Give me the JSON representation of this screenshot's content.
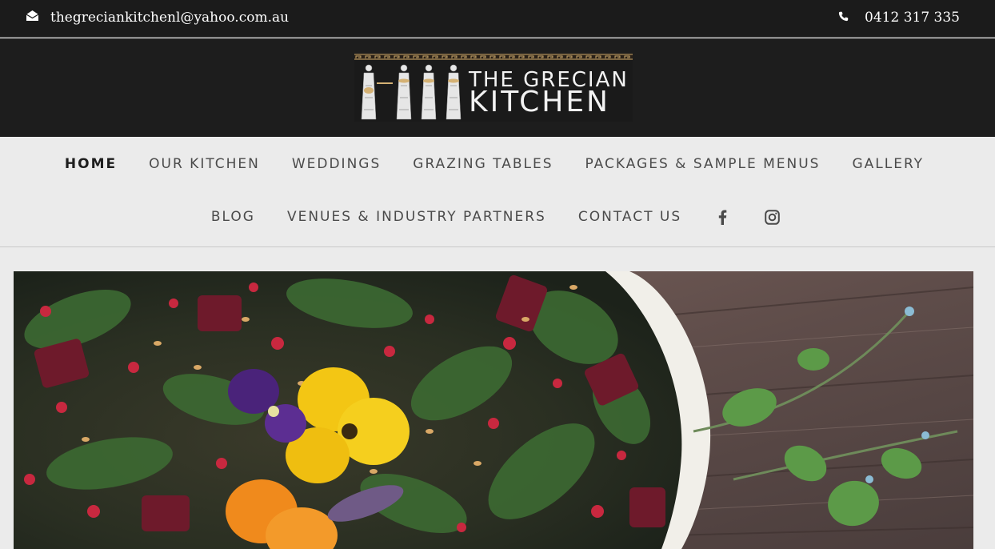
{
  "topbar": {
    "email": "thegreciankitchenl@yahoo.com.au",
    "phone": "0412 317 335",
    "email_icon": "envelope-open-icon",
    "phone_icon": "phone-icon"
  },
  "logo": {
    "line1": "THE GRECIAN",
    "line2": "KITCHEN"
  },
  "nav": {
    "row1": [
      "HOME",
      "OUR KITCHEN",
      "WEDDINGS",
      "GRAZING TABLES",
      "PACKAGES & SAMPLE MENUS",
      "GALLERY"
    ],
    "row2": [
      "BLOG",
      "VENUES & INDUSTRY PARTNERS",
      "CONTACT US"
    ],
    "active": "HOME",
    "social_icons": [
      "facebook-icon",
      "instagram-icon"
    ]
  },
  "colors": {
    "topbar_bg": "#1b1b1b",
    "header_bg": "#1d1d1d",
    "nav_bg": "#ebebeb",
    "nav_text": "#4a4a4a",
    "nav_active": "#1e1e1e"
  }
}
